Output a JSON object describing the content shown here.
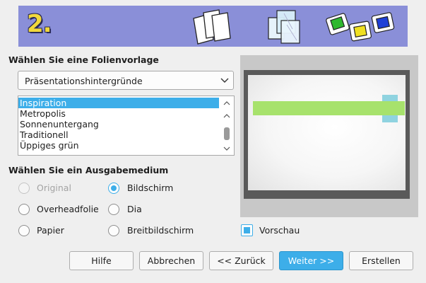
{
  "header": {
    "step": "2."
  },
  "template_section": {
    "title": "Wählen Sie eine Folienvorlage",
    "category_selected": "Präsentationshintergründe",
    "templates": [
      {
        "label": "Inspiration",
        "selected": true
      },
      {
        "label": "Metropolis",
        "selected": false
      },
      {
        "label": "Sonnenuntergang",
        "selected": false
      },
      {
        "label": "Traditionell",
        "selected": false
      },
      {
        "label": "Üppiges grün",
        "selected": false
      }
    ]
  },
  "medium_section": {
    "title": "Wählen Sie ein Ausgabemedium",
    "options": [
      {
        "label": "Original",
        "checked": false,
        "enabled": false
      },
      {
        "label": "Bildschirm",
        "checked": true,
        "enabled": true
      },
      {
        "label": "Overheadfolie",
        "checked": false,
        "enabled": true
      },
      {
        "label": "Dia",
        "checked": false,
        "enabled": true
      },
      {
        "label": "Papier",
        "checked": false,
        "enabled": true
      },
      {
        "label": "Breitbildschirm",
        "checked": false,
        "enabled": true
      }
    ]
  },
  "preview": {
    "label": "Vorschau",
    "checked": true
  },
  "buttons": {
    "help": "Hilfe",
    "cancel": "Abbrechen",
    "back": "<< Zurück",
    "next": "Weiter >>",
    "create": "Erstellen"
  },
  "colors": {
    "accent": "#3daee9",
    "banner": "#8a8fd8",
    "step_number": "#f1d83b",
    "preview_green": "#a7e26c",
    "preview_cyan": "#8fd3e0"
  }
}
